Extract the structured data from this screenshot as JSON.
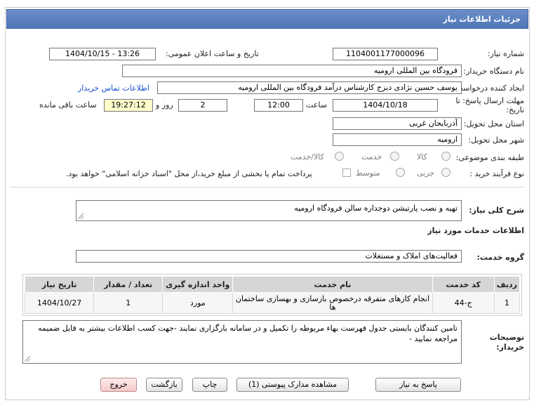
{
  "title": "جزئیات اطلاعات نیاز",
  "need_number": {
    "label": "شماره نیاز:",
    "value": "1104001177000096"
  },
  "announce": {
    "label": "تاریخ و ساعت اعلان عمومی:",
    "value": "1404/10/15 - 13:26"
  },
  "buyer_org": {
    "label": "نام دستگاه خریدار:",
    "value": "فرودگاه بین المللی ارومیه"
  },
  "creator": {
    "label": "ایجاد کننده درخواست:",
    "value": "یوسف حسین نژادی دیزج کارشناس درآمد فرودگاه بین المللی ارومیه",
    "contact_link": "اطلاعات تماس خریدار"
  },
  "deadline": {
    "label_line1": "مهلت ارسال پاسخ: تا",
    "label_line2": "تاریخ:",
    "date": "1404/10/18",
    "time_label": "ساعت",
    "time": "12:00",
    "days": "2",
    "days_label": "روز و",
    "remaining": "19:27:12",
    "remaining_label": "ساعت باقی مانده"
  },
  "province": {
    "label": "استان محل تحویل:",
    "value": "آذربایجان غربی"
  },
  "city": {
    "label": "شهر محل تحویل:",
    "value": "ارومیه"
  },
  "category": {
    "label": "طبقه بندی موضوعی:",
    "options": [
      "کالا",
      "خدمت",
      "کالا/خدمت"
    ]
  },
  "process": {
    "label": "نوع فرآیند خرید :",
    "options": [
      "جزیی",
      "متوسط"
    ],
    "note": "پرداخت تمام یا بخشی از مبلغ خرید،از محل \"اسناد خزانه اسلامی\" خواهد بود."
  },
  "summary": {
    "label": "شرح کلی نیاز:",
    "value": "تهیه و نصب پارتیشن دوجداره سالن  فرودگاه ارومیه"
  },
  "services_title": "اطلاعات خدمات مورد نیاز",
  "service_group": {
    "label": "گروه خدمت:",
    "value": "فعالیت‌های  املاک و مستغلات"
  },
  "table": {
    "headers": [
      "ردیف",
      "کد خدمت",
      "نام خدمت",
      "واحد اندازه گیری",
      "تعداد / مقدار",
      "تاریخ نیاز"
    ],
    "rows": [
      [
        "1",
        "ج-44",
        "انجام کارهای متفرقه درخصوص بازسازی و بهسازی ساختمان ها",
        "مورد",
        "1",
        "1404/10/27"
      ]
    ]
  },
  "buyer_notes": {
    "label_line1": "توضیحات",
    "label_line2": "خریدار:",
    "value": "تامین کنندگان بایستی جدول فهرست بهاء مربوطه را تکمیل و در سامانه بارگزاری نمایند -جهت کسب اطلاعات بیشتر به فایل ضمیمه مراجعه نمایید -"
  },
  "buttons": {
    "reply": "پاسخ به نیاز",
    "docs": "مشاهده مدارک پیوستی (1)",
    "print": "چاپ",
    "back": "بازگشت",
    "exit": "خروج"
  }
}
